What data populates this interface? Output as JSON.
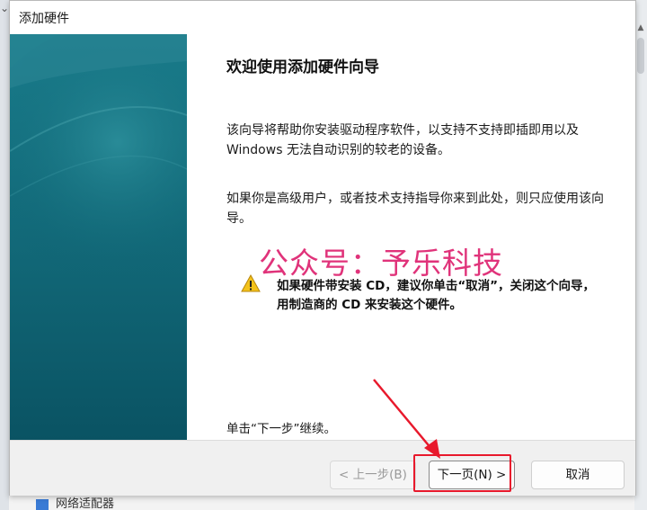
{
  "dialog": {
    "title": "添加硬件",
    "heading": "欢迎使用添加硬件向导",
    "paragraph1": "该向导将帮助你安装驱动程序软件，以支持不支持即插即用以及 Windows 无法自动识别的较老的设备。",
    "paragraph2": "如果你是高级用户，或者技术支持指导你来到此处，则只应使用该向导。",
    "warning": "如果硬件带安装 CD，建议你单击“取消”，关闭这个向导，用制造商的 CD 来安装这个硬件。",
    "continue_hint": "单击“下一步”继续。"
  },
  "watermark": "公众号：予乐科技",
  "buttons": {
    "back": "< 上一步(B)",
    "next": "下一页(N) >",
    "cancel": "取消"
  },
  "background": {
    "bottom_item": "网络适配器"
  },
  "colors": {
    "side_panel": "#0f6c7d",
    "watermark": "#e0337a",
    "highlight": "#e8192c"
  },
  "icons": {
    "warning": "warning-triangle-icon"
  }
}
